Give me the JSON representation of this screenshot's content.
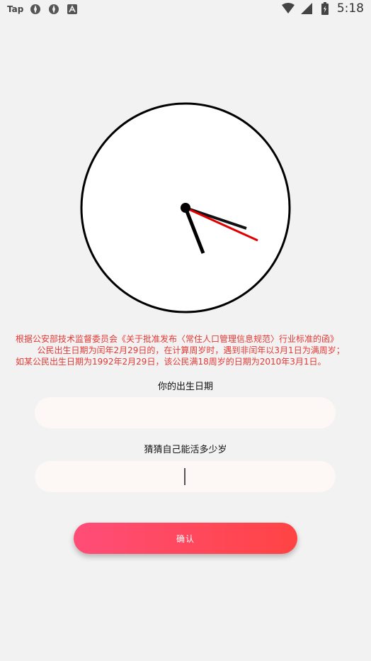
{
  "status_bar": {
    "app_tag": "Tap",
    "time": "5:18",
    "icons": [
      "gear-notification-icon",
      "gear-notification-icon",
      "a-notification-icon",
      "wifi-icon",
      "signal-icon",
      "battery-icon"
    ]
  },
  "clock": {
    "hour_hand": "5",
    "minute_hand": "21",
    "second_hand": "20"
  },
  "notice": {
    "text": "根据公安部技术监督委员会《关于批准发布〈常住人口管理信息规范〉行业标准的函》\n        公民出生日期为闰年2月29日的，在计算周岁时，遇到非闰年以3月1日为满周岁；\n如某公民出生日期为1992年2月29日，该公民满18周岁的日期为2010年3月1日。"
  },
  "form": {
    "birth_label": "你的出生日期",
    "birth_value": "",
    "guess_label": "猜猜自己能活多少岁",
    "guess_value": ""
  },
  "confirm_label": "确认",
  "colors": {
    "background": "#f2f2f2",
    "notice": "#e53935",
    "button_start": "#ff4d78",
    "button_end": "#ff4444",
    "second_hand": "#e00000"
  }
}
